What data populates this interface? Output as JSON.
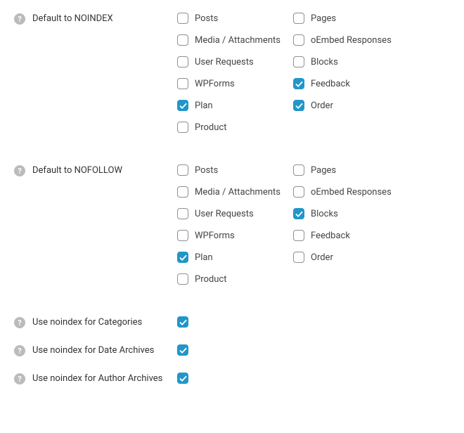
{
  "sections": {
    "noindex": {
      "label": "Default to NOINDEX",
      "options": [
        {
          "label": "Posts",
          "checked": false
        },
        {
          "label": "Pages",
          "checked": false
        },
        {
          "label": "Media / Attachments",
          "checked": false
        },
        {
          "label": "oEmbed Responses",
          "checked": false
        },
        {
          "label": "User Requests",
          "checked": false
        },
        {
          "label": "Blocks",
          "checked": false
        },
        {
          "label": "WPForms",
          "checked": false
        },
        {
          "label": "Feedback",
          "checked": true
        },
        {
          "label": "Plan",
          "checked": true
        },
        {
          "label": "Order",
          "checked": true
        },
        {
          "label": "Product",
          "checked": false
        }
      ]
    },
    "nofollow": {
      "label": "Default to NOFOLLOW",
      "options": [
        {
          "label": "Posts",
          "checked": false
        },
        {
          "label": "Pages",
          "checked": false
        },
        {
          "label": "Media / Attachments",
          "checked": false
        },
        {
          "label": "oEmbed Responses",
          "checked": false
        },
        {
          "label": "User Requests",
          "checked": false
        },
        {
          "label": "Blocks",
          "checked": true
        },
        {
          "label": "WPForms",
          "checked": false
        },
        {
          "label": "Feedback",
          "checked": false
        },
        {
          "label": "Plan",
          "checked": true
        },
        {
          "label": "Order",
          "checked": false
        },
        {
          "label": "Product",
          "checked": false
        }
      ]
    },
    "categories": {
      "label": "Use noindex for Categories",
      "checked": true
    },
    "date_archives": {
      "label": "Use noindex for Date Archives",
      "checked": true
    },
    "author_archives": {
      "label": "Use noindex for Author Archives",
      "checked": true
    }
  }
}
